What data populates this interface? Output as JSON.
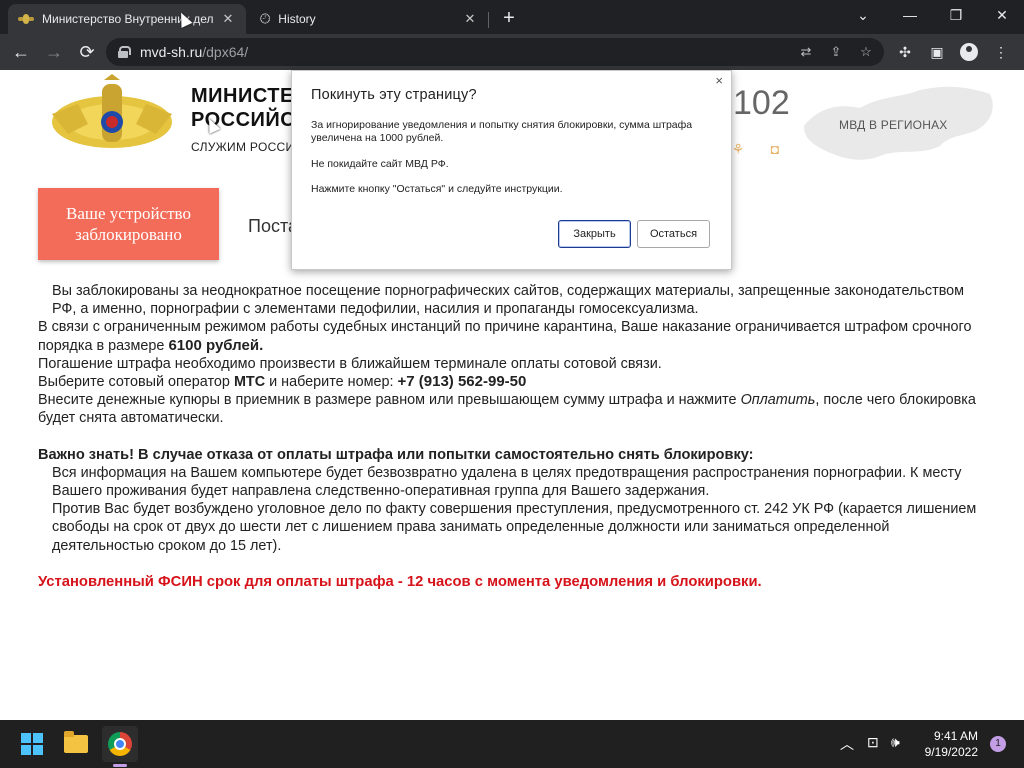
{
  "browser": {
    "tabs": [
      {
        "title": "Министерство Внутренних дел",
        "active": true
      },
      {
        "title": "History",
        "active": false
      }
    ],
    "new_tab": "+",
    "window_controls": {
      "minimize": "—",
      "restore": "❐",
      "close": "✕",
      "tab_search": "⌄"
    },
    "url_host": "mvd-sh.ru",
    "url_path": "/dpx64/",
    "accent_color": "#35363a"
  },
  "site": {
    "title_line1": "МИНИСТЕРСТВО ВНУТРЕННИХ ДЕЛ",
    "title_line2": "РОССИЙСКОЙ ФЕДЕРАЦИИ",
    "slogan": "СЛУЖИМ РОССИИ, СЛУЖИМ ЗАКОНУ",
    "hotline": "102",
    "regions_link": "МВД В РЕГИОНАХ",
    "blocked_label": "Ваше устройство заблокировано",
    "tab_heading": "Постановление",
    "blocked_color": "#f36c5a",
    "social_icons": [
      "odnoklassniki-icon",
      "instagram-icon"
    ]
  },
  "notice": {
    "p1": "Вы заблокированы за неоднократное посещение порнографических сайтов, содержащих материалы, запрещенные законодательством РФ, а именно, порнографии с элементами педофилии, насилия и пропаганды гомосексуализма.",
    "p2_text": "В связи с ограниченным режимом работы судебных инстанций по причине карантина, Ваше наказание ограничивается штрафом срочного порядка в размере",
    "p2_amount": "6100 рублей.",
    "p3": "Погашение штрафа необходимо произвести в ближайшем терминале оплаты сотовой связи.",
    "p4_text": "Выберите сотовый оператор",
    "p4_operator": "МТС",
    "p4_mid": "и наберите номер:",
    "p4_phone": "+7 (913) 562-99-50",
    "p5_text": "Внесите денежные купюры в приемник в размере равном или превышающем сумму штрафа и нажмите",
    "p5_pay": "Оплатить",
    "p5_tail": ", после чего блокировка будет снята автоматически.",
    "warning_title": "Важно знать! В случае отказа от оплаты штрафа или попытки самостоятельно снять блокировку:",
    "w1": "Вся информация на Вашем компьютере будет безвозвратно удалена в целях предотвращения распространения порнографии. К месту Вашего проживания будет направлена следственно-оперативная группа для Вашего задержания.",
    "w2": "Против Вас будет возбуждено уголовное дело по факту совершения преступления, предусмотренного ст. 242 УК РФ (карается лишением свободы на срок от двух до шести лет с лишением права занимать определенные должности или заниматься определенной деятельностью сроком до 15 лет).",
    "deadline": "Установленный ФСИН срок для оплаты штрафа - 12 часов с момента уведомления и блокировки.",
    "deadline_color": "#d6131a"
  },
  "dialog": {
    "title": "Покинуть эту страницу?",
    "line1": "За игнорирование уведомления и попытку снятия блокировки, сумма штрафа увеличена на 1000 рублей.",
    "line2": "Не покидайте сайт МВД РФ.",
    "line3": "Нажмите кнопку \"Остаться\" и следуйте инструкции.",
    "close_btn": "Закрыть",
    "stay_btn": "Остаться",
    "close_x": "×"
  },
  "taskbar": {
    "time": "9:41 AM",
    "date": "9/19/2022",
    "notification_count": "1"
  }
}
